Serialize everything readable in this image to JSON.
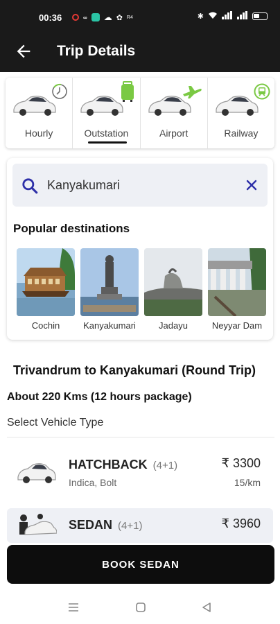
{
  "status_bar": {
    "time": "00:36",
    "network_label": "R4",
    "background_color": "#1a1a1a"
  },
  "app_bar": {
    "title": "Trip Details",
    "back_icon": "arrow-left-icon"
  },
  "trip_types": [
    {
      "label": "Hourly",
      "badge_icon": "clock-icon",
      "selected": false
    },
    {
      "label": "Outstation",
      "badge_icon": "luggage-icon",
      "selected": true
    },
    {
      "label": "Airport",
      "badge_icon": "airplane-icon",
      "selected": false
    },
    {
      "label": "Railway",
      "badge_icon": "train-icon",
      "selected": false
    }
  ],
  "search": {
    "value": "Kanyakumari",
    "icon": "search-icon",
    "clear_icon": "close-icon",
    "accent_color": "#2d2fa8"
  },
  "popular": {
    "title": "Popular destinations",
    "items": [
      {
        "label": "Cochin"
      },
      {
        "label": "Kanyakumari"
      },
      {
        "label": "Jadayu"
      },
      {
        "label": "Neyyar Dam"
      }
    ]
  },
  "trip": {
    "route": "Trivandrum to Kanyakumari (Round Trip)",
    "distance": "About 220 Kms (12 hours package)",
    "select_label": "Select Vehicle Type"
  },
  "vehicles": [
    {
      "name": "HATCHBACK",
      "capacity": "(4+1)",
      "models": "Indica, Bolt",
      "price": "₹ 3300",
      "rate": "15/km"
    },
    {
      "name": "SEDAN",
      "capacity": "(4+1)",
      "price": "₹ 3960"
    }
  ],
  "book_button": {
    "label": "BOOK SEDAN"
  },
  "colors": {
    "green_badge": "#7ac943",
    "dark": "#1a1a1a",
    "panel": "#eef0f5"
  }
}
